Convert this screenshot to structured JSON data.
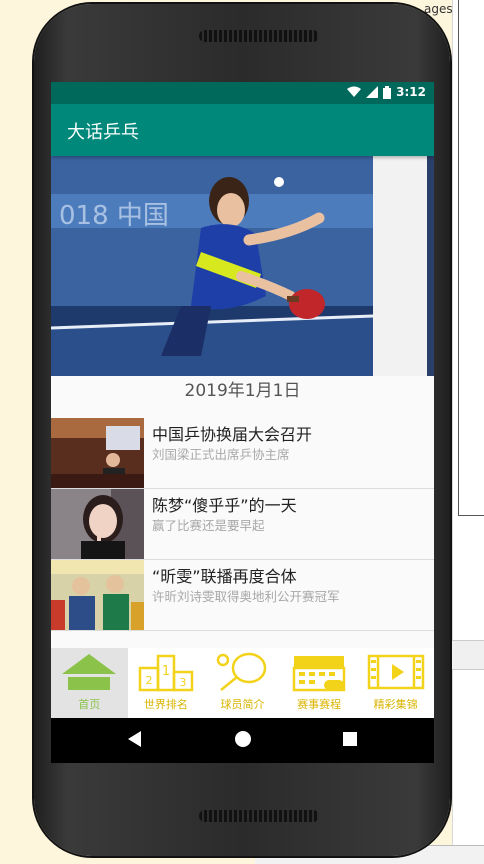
{
  "desktop": {
    "tab_fragment": "ages",
    "prompt_char": ">"
  },
  "status_bar": {
    "time": "3:12",
    "bg": "#00695c"
  },
  "app": {
    "title": "大话乒乓",
    "accent": "#00897b"
  },
  "banner": {
    "caption": "2019年1月1日"
  },
  "news": [
    {
      "title": "中国乒协换届大会召开",
      "subtitle": "刘国梁正式出席乒协主席"
    },
    {
      "title": "陈梦“傻乎乎”的一天",
      "subtitle": "赢了比赛还是要早起"
    },
    {
      "title": "“昕雯”联播再度合体",
      "subtitle": "许昕刘诗雯取得奥地利公开赛冠军"
    }
  ],
  "tabs": [
    {
      "label": "首页",
      "icon": "home-icon",
      "active": true
    },
    {
      "label": "世界排名",
      "icon": "podium-icon",
      "active": false
    },
    {
      "label": "球员简介",
      "icon": "paddle-icon",
      "active": false
    },
    {
      "label": "赛事赛程",
      "icon": "calendar-icon",
      "active": false
    },
    {
      "label": "精彩集锦",
      "icon": "video-icon",
      "active": false
    }
  ],
  "colors": {
    "tab_active": "#8bc34a",
    "tab_inactive": "#d9b400"
  }
}
